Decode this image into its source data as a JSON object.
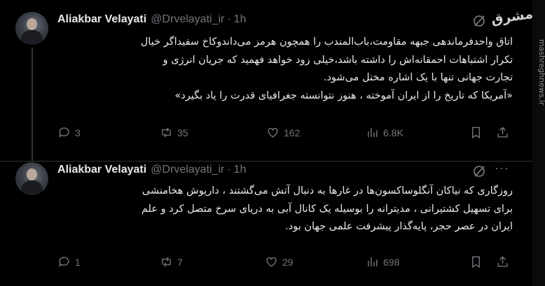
{
  "tweets": [
    {
      "author_name": "Aliakbar Velayati",
      "handle": "@Drvelayati_ir",
      "separator": "·",
      "time": "1h",
      "text_lines": [
        "اتاق واحدفرماندهی جبهه مقاومت،باب‌المندب را همچون هرمز می‌داندوکاخ سفیداگر خیال",
        "تکرار اشتباهات احمقانه‌اش را داشته باشد،خیلی زود خواهد فهمید که جریان انرژی و",
        "تجارت جهانی تنها با یک اشاره مختل می‌شود.",
        "«آمریکا که تاریخ را از ایران آموخته ، هنوز نتوانسته جغرافیای قدرت را یاد بگیرد»"
      ],
      "replies": "3",
      "reposts": "35",
      "likes": "162",
      "views": "6.8K"
    },
    {
      "author_name": "Aliakbar Velayati",
      "handle": "@Drvelayati_ir",
      "separator": "·",
      "time": "1h",
      "text_lines": [
        "روزگاری که نیاکان آنگلوساکسون‌ها در غارها به دنبال آتش می‌گشتند ، داریوش هخامنشی",
        "برای تسهیل کشتیرانی ، مدیترانه را بوسیله یک کانال آبی به دریای سرخ متصل کرد و علم",
        "ایران در عصر حجر، پایه‌گذار پیشرفت علمی جهان  بود."
      ],
      "replies": "1",
      "reposts": "7",
      "likes": "29",
      "views": "698"
    }
  ],
  "brand_logo": "مشرق",
  "watermark": "mashreghnews.ir",
  "icons": [
    "grok-icon",
    "more-icon",
    "reply-icon",
    "repost-icon",
    "like-icon",
    "views-icon",
    "bookmark-icon",
    "share-icon"
  ],
  "colors": {
    "background": "#000000",
    "text": "#e7e9ea",
    "muted": "#71767b",
    "divider": "#2f3336"
  }
}
